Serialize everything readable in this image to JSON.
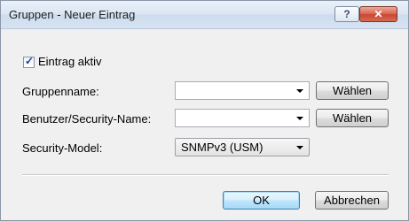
{
  "window": {
    "title": "Gruppen - Neuer Eintrag",
    "help_label": "?",
    "close_label": "✕"
  },
  "form": {
    "active": {
      "label": "Eintrag aktiv",
      "checked": true
    },
    "group_name": {
      "label": "Gruppenname:",
      "value": "",
      "button_label": "Wählen"
    },
    "user_name": {
      "label": "Benutzer/Security-Name:",
      "value": "",
      "button_label": "Wählen"
    },
    "security_model": {
      "label": "Security-Model:",
      "value": "SNMPv3 (USM)"
    }
  },
  "footer": {
    "ok_label": "OK",
    "cancel_label": "Abbrechen"
  }
}
